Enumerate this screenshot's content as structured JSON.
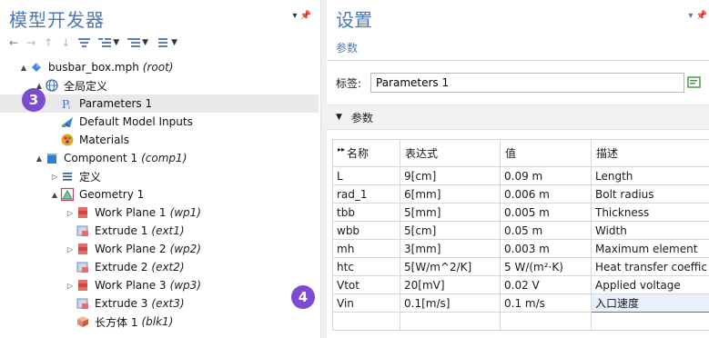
{
  "left_panel": {
    "title": "模型开发器",
    "tree": [
      {
        "label": "busbar_box.mph",
        "tag": "(root)",
        "indent": 0,
        "expander": "▲",
        "icon": "root-model-icon"
      },
      {
        "label": "全局定义",
        "tag": "",
        "indent": 1,
        "expander": "▲",
        "icon": "globe-icon"
      },
      {
        "label": "Parameters 1",
        "tag": "",
        "indent": 2,
        "expander": "",
        "icon": "parameters-icon",
        "selected": true
      },
      {
        "label": "Default Model Inputs",
        "tag": "",
        "indent": 2,
        "expander": "",
        "icon": "model-inputs-icon"
      },
      {
        "label": "Materials",
        "tag": "",
        "indent": 2,
        "expander": "",
        "icon": "materials-icon"
      },
      {
        "label": "Component 1",
        "tag": "(comp1)",
        "indent": 1,
        "expander": "▲",
        "icon": "component-icon"
      },
      {
        "label": "定义",
        "tag": "",
        "indent": 2,
        "expander": "▷",
        "icon": "definitions-icon"
      },
      {
        "label": "Geometry 1",
        "tag": "",
        "indent": 2,
        "expander": "▲",
        "icon": "geometry-icon"
      },
      {
        "label": "Work Plane 1",
        "tag": "(wp1)",
        "indent": 3,
        "expander": "▷",
        "icon": "work-plane-icon"
      },
      {
        "label": "Extrude 1",
        "tag": "(ext1)",
        "indent": 3,
        "expander": "",
        "icon": "extrude-icon"
      },
      {
        "label": "Work Plane 2",
        "tag": "(wp2)",
        "indent": 3,
        "expander": "▷",
        "icon": "work-plane-icon"
      },
      {
        "label": "Extrude 2",
        "tag": "(ext2)",
        "indent": 3,
        "expander": "",
        "icon": "extrude-icon"
      },
      {
        "label": "Work Plane 3",
        "tag": "(wp3)",
        "indent": 3,
        "expander": "▷",
        "icon": "work-plane-icon"
      },
      {
        "label": "Extrude 3",
        "tag": "(ext3)",
        "indent": 3,
        "expander": "",
        "icon": "extrude-icon"
      },
      {
        "label": "长方体 1",
        "tag": "(blk1)",
        "indent": 3,
        "expander": "",
        "icon": "block-icon"
      }
    ]
  },
  "badges": {
    "step3": "3",
    "step4": "4"
  },
  "settings": {
    "title": "设置",
    "subtitle": "参数",
    "label_key": "标签:",
    "label_value": "Parameters 1",
    "section": "参数",
    "columns": [
      "名称",
      "表达式",
      "值",
      "描述"
    ],
    "rows": [
      [
        "L",
        "9[cm]",
        "0.09 m",
        "Length"
      ],
      [
        "rad_1",
        "6[mm]",
        "0.006 m",
        "Bolt radius"
      ],
      [
        "tbb",
        "5[mm]",
        "0.005 m",
        "Thickness"
      ],
      [
        "wbb",
        "5[cm]",
        "0.05 m",
        "Width"
      ],
      [
        "mh",
        "3[mm]",
        "0.003 m",
        "Maximum element"
      ],
      [
        "htc",
        "5[W/m^2/K]",
        "5 W/(m²·K)",
        "Heat transfer coeffic"
      ],
      [
        "Vtot",
        "20[mV]",
        "0.02 V",
        "Applied voltage"
      ],
      [
        "Vin",
        "0.1[m/s]",
        "0.1 m/s",
        "入口速度"
      ],
      [
        "",
        "",
        "",
        ""
      ]
    ]
  },
  "colors": {
    "accent": "#4a78b8",
    "badge": "#7b4bd0",
    "selection": "#e9e9e9"
  }
}
